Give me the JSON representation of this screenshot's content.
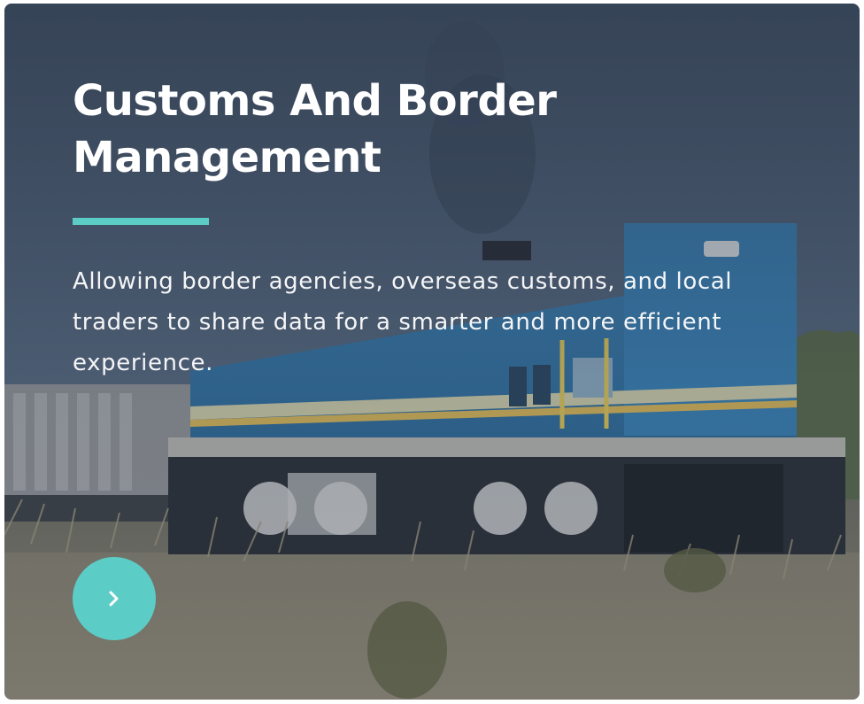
{
  "card": {
    "title": "Customs And Border Management",
    "description": "Allowing border agencies, overseas customs, and local traders to share data for a smarter and more efficient experience.",
    "next_button_icon": "chevron-right-icon",
    "background_image": "locomotive train on tracks in dry grassland"
  },
  "colors": {
    "accent": "#5ccdc6",
    "title_text": "#ffffff",
    "overlay": "#2c3a4e"
  }
}
